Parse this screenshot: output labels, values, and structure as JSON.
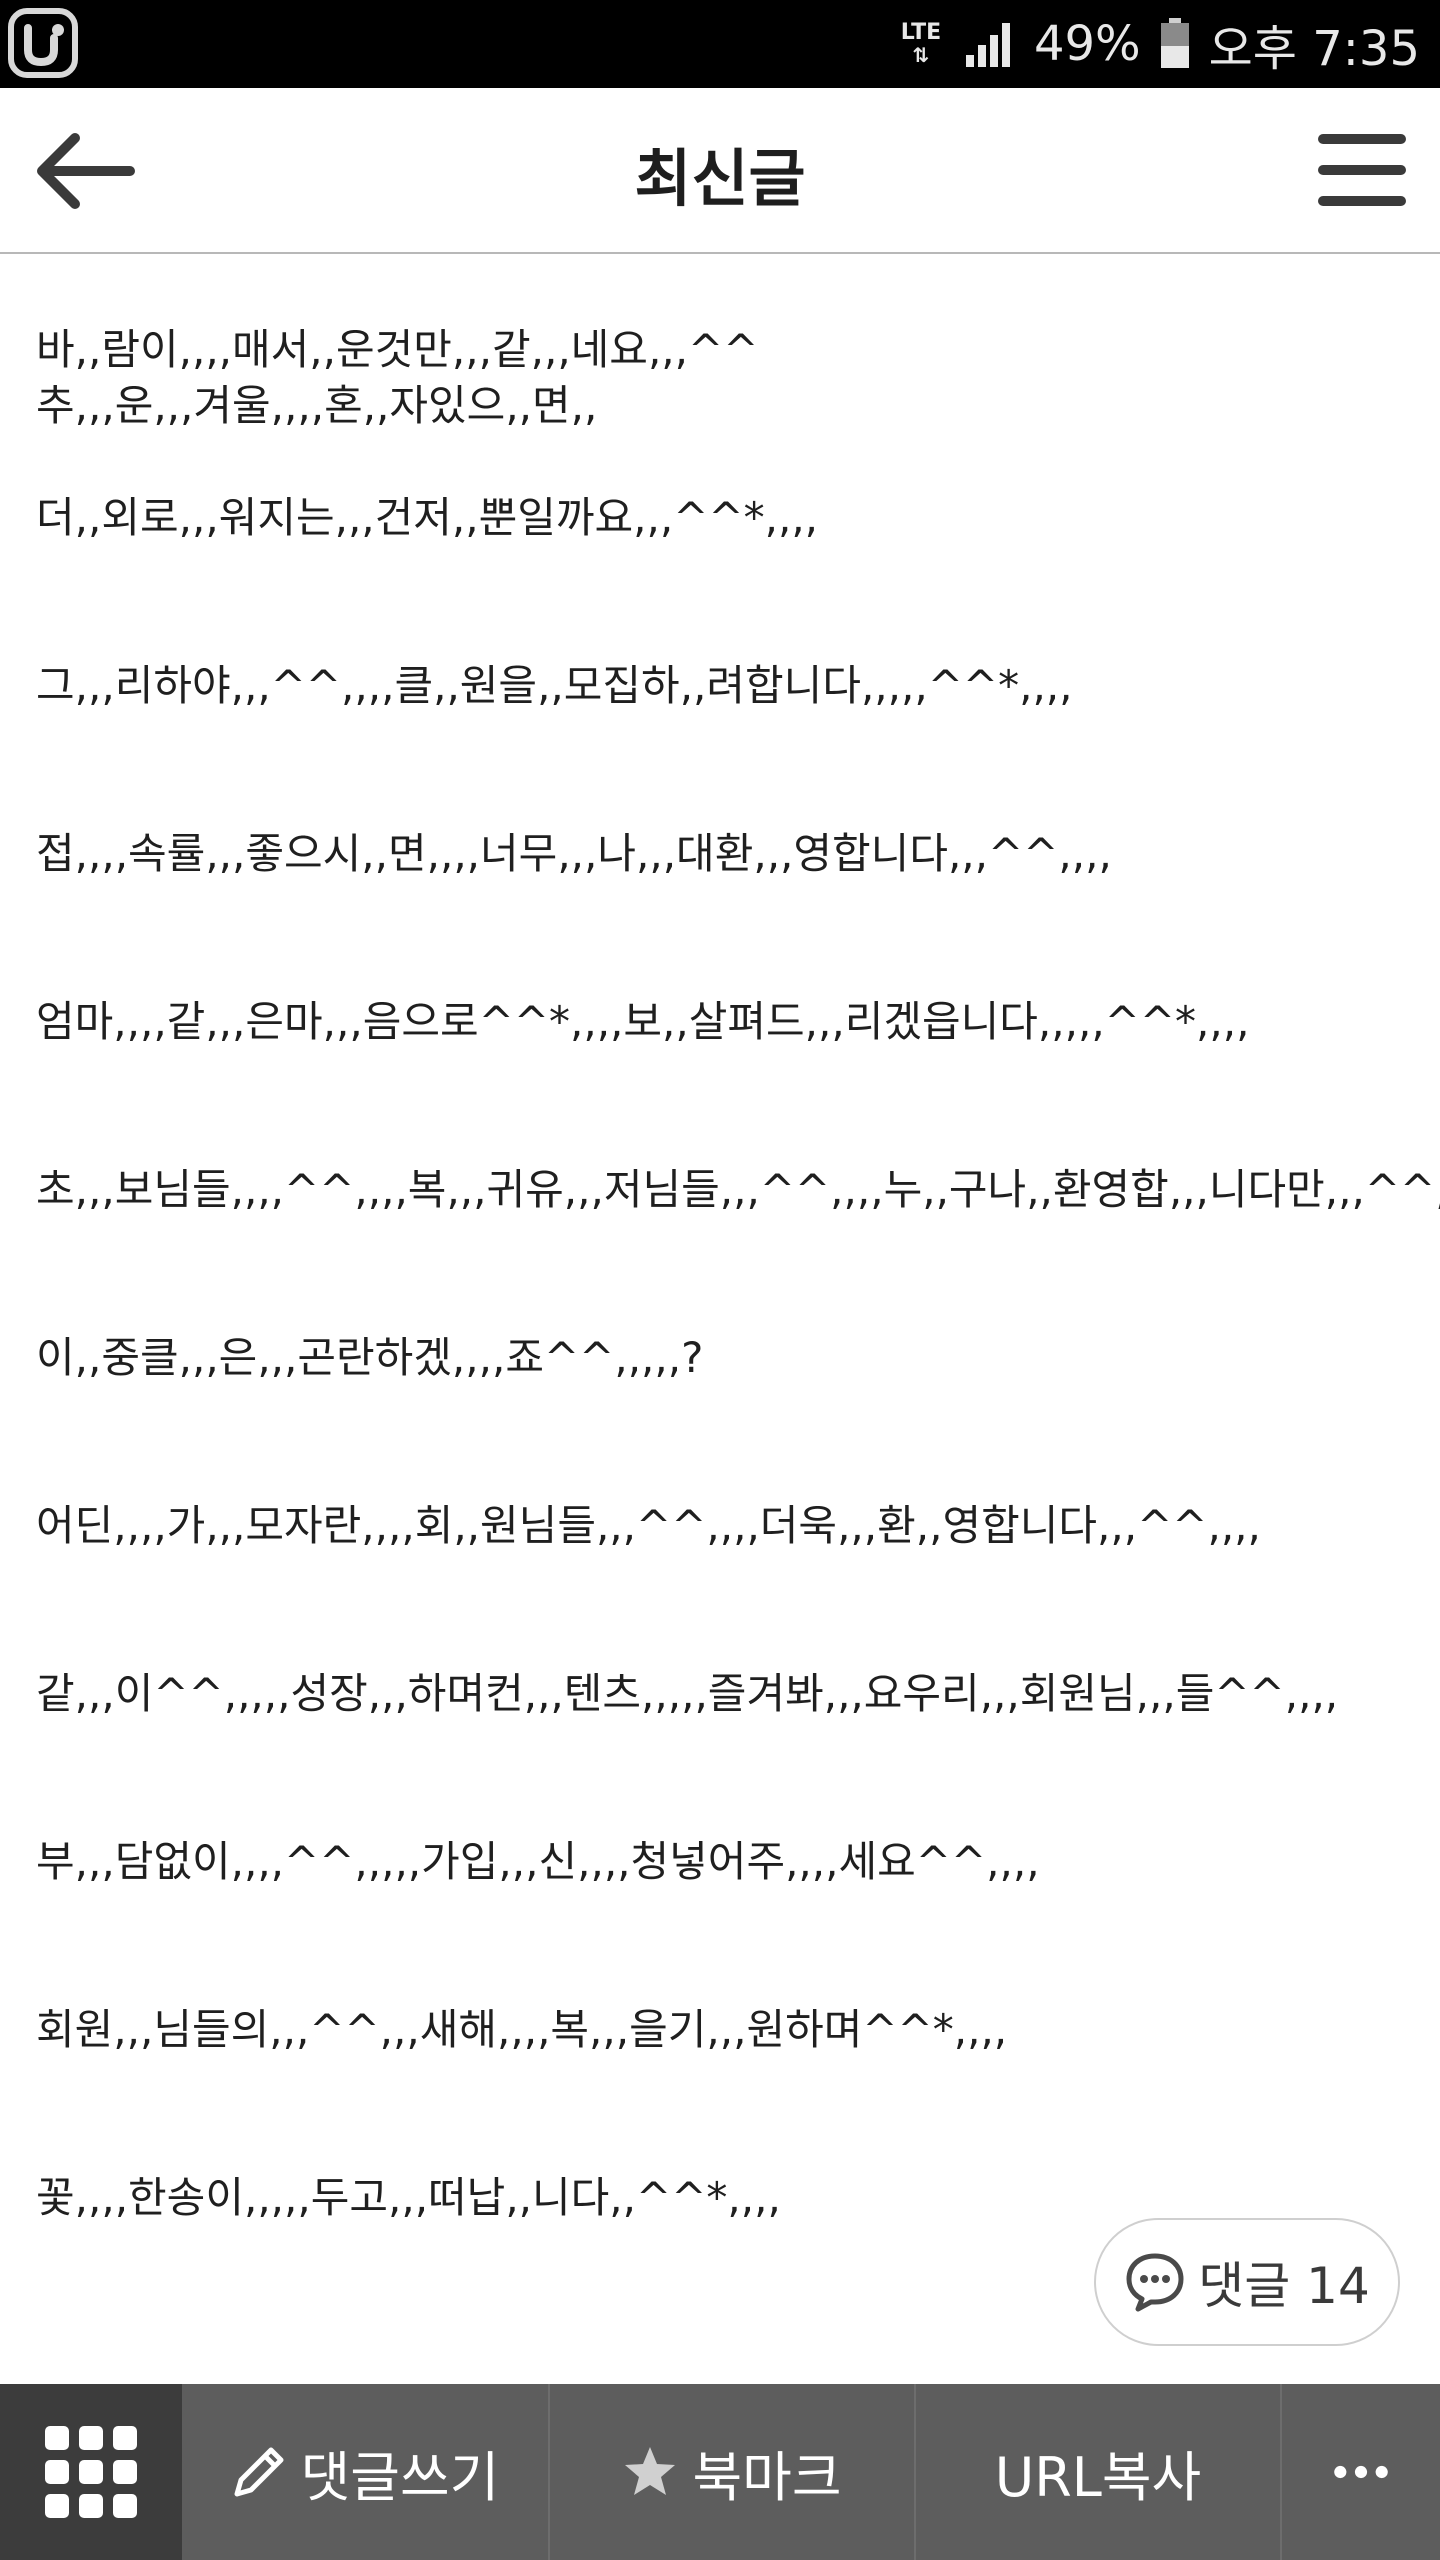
{
  "status_bar": {
    "network": "LTE",
    "battery": "49%",
    "time": "오후 7:35"
  },
  "header": {
    "title": "최신글"
  },
  "post": {
    "lines": [
      "바,,람이,,,,매서,,운것만,,,같,,,네요,,,^^",
      "추,,,운,,,겨울,,,,혼,,자있으,,면,,",
      "",
      "더,,외로,,,워지는,,,건저,,뿐일까요,,,^^*,,,,",
      "",
      "",
      "그,,,리하야,,,^^,,,,클,,원을,,모집하,,려합니다,,,,,^^*,,,,",
      "",
      "",
      "접,,,,속률,,,좋으시,,면,,,,너무,,,나,,,대환,,,영합니다,,,^^,,,,",
      "",
      "",
      "엄마,,,,같,,,은마,,,음으로^^*,,,,보,,살펴드,,,리겠읍니다,,,,,^^*,,,,",
      "",
      "",
      "초,,,보님들,,,,^^,,,,복,,,귀유,,,저님들,,,^^,,,,누,,구나,,환영합,,,니다만,,,^^,,,,",
      "",
      "",
      "이,,중클,,,은,,,곤란하겠,,,,죠^^,,,,,?",
      "",
      "",
      "어딘,,,,가,,,모자란,,,,회,,원님들,,,^^,,,,더욱,,,환,,영합니다,,,^^,,,,",
      "",
      "",
      "같,,,이^^,,,,,성장,,,하며컨,,,텐츠,,,,,즐겨봐,,,요우리,,,회원님,,,들^^,,,,",
      "",
      "",
      "부,,,담없이,,,,^^,,,,,가입,,,신,,,,청넣어주,,,,세요^^,,,,",
      "",
      "",
      "회원,,,님들의,,,^^,,,새해,,,,복,,,을기,,,원하며^^*,,,,",
      "",
      "",
      "꽃,,,,한송이,,,,,두고,,,떠납,,니다,,^^*,,,,"
    ]
  },
  "comment_button": {
    "label": "댓글 14"
  },
  "bottom_bar": {
    "write_comment": "댓글쓰기",
    "bookmark": "북마크",
    "copy_url": "URL복사"
  },
  "icons": {
    "app_logo": "app-logo-icon",
    "signal": "signal-icon",
    "battery": "battery-icon",
    "back": "back-arrow-icon",
    "menu": "hamburger-menu-icon",
    "comment": "speech-bubble-icon",
    "grid": "grid-icon",
    "pencil": "pencil-icon",
    "star": "star-icon",
    "more": "more-dots-icon"
  }
}
